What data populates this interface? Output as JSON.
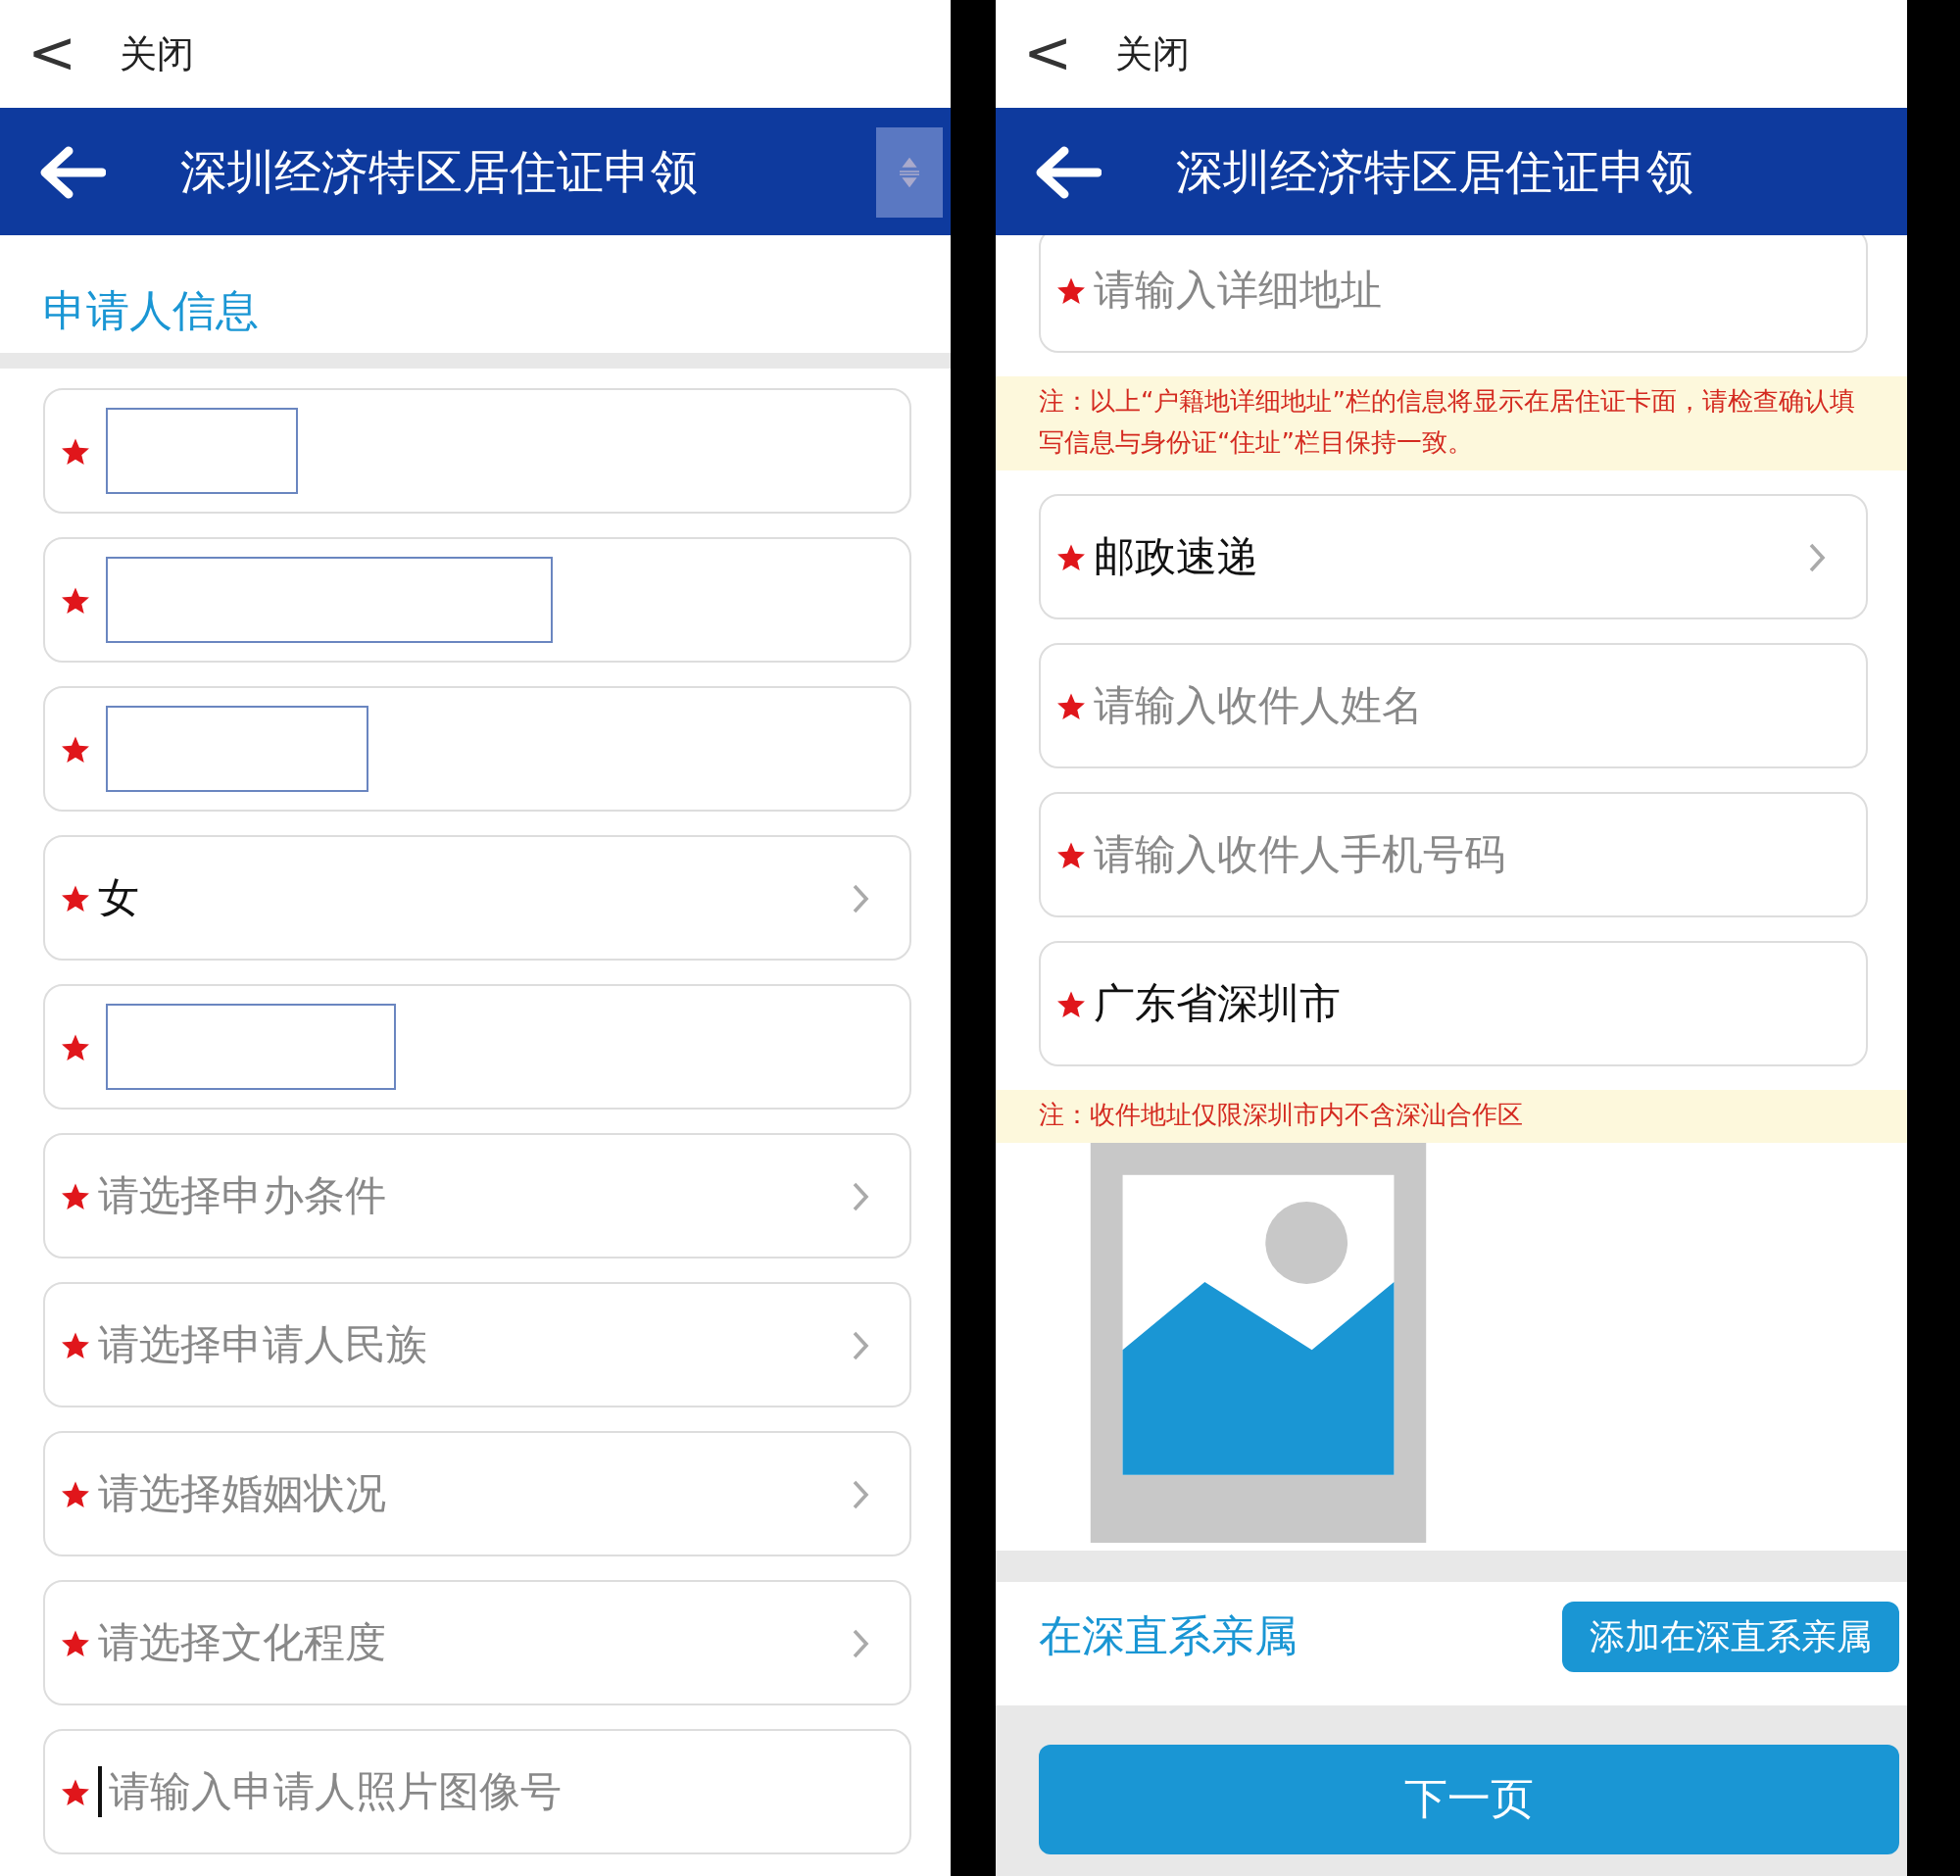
{
  "screens": [
    {
      "top_bar": {
        "back": "<",
        "title": "关闭"
      },
      "header": {
        "title": "深圳经济特区居住证申领",
        "actions": [
          {
            "kind": "sort"
          }
        ]
      },
      "section": {
        "title": "申请人信息"
      },
      "fields": [
        {
          "kind": "redacted",
          "required": true
        },
        {
          "kind": "redacted",
          "required": true
        },
        {
          "kind": "redacted",
          "required": true
        },
        {
          "kind": "select",
          "required": true,
          "value": "女"
        },
        {
          "kind": "redacted",
          "required": true
        },
        {
          "kind": "select",
          "required": true,
          "placeholder": "请选择申办条件"
        },
        {
          "kind": "select",
          "required": true,
          "placeholder": "请选择申请人民族"
        },
        {
          "kind": "select",
          "required": true,
          "placeholder": "请选择婚姻状况"
        },
        {
          "kind": "select",
          "required": true,
          "placeholder": "请选择文化程度"
        },
        {
          "kind": "input",
          "required": true,
          "placeholder": "请输入申请人照片图像号",
          "focused": true
        }
      ]
    },
    {
      "top_bar": {
        "back": "<",
        "title": "关闭"
      },
      "header": {
        "title": "深圳经济特区居住证申领"
      },
      "fields": [
        {
          "kind": "input",
          "required": true,
          "placeholder": "请输入详细地址"
        },
        {
          "kind": "note",
          "text": "注：以上“户籍地详细地址”栏的信息将显示在居住证卡面，请检查确认填写信息与身份证“住址”栏目保持一致。"
        },
        {
          "kind": "select",
          "required": true,
          "value": "邮政速递"
        },
        {
          "kind": "input",
          "required": true,
          "placeholder": "请输入收件人姓名"
        },
        {
          "kind": "input",
          "required": true,
          "placeholder": "请输入收件人手机号码"
        },
        {
          "kind": "input",
          "required": true,
          "value": "广东省深圳市"
        },
        {
          "kind": "note",
          "text": "注：收件地址仅限深圳市内不含深汕合作区"
        },
        {
          "kind": "photo"
        }
      ],
      "relatives": {
        "title": "在深直系亲属",
        "button": "添加在深直系亲属"
      },
      "next_button": "下一页"
    }
  ]
}
